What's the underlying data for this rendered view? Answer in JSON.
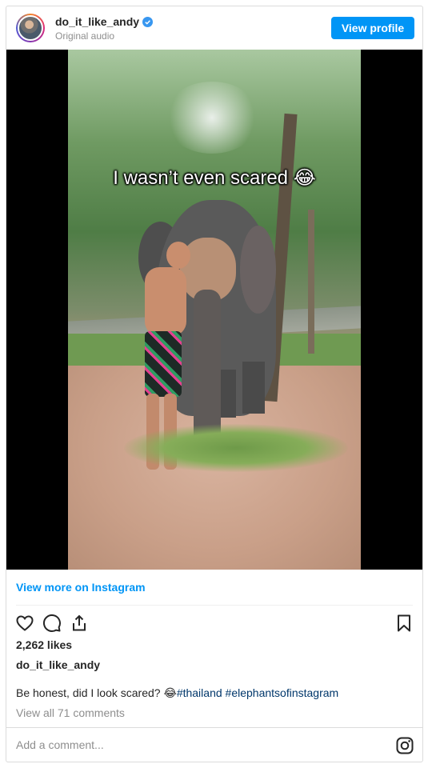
{
  "header": {
    "username": "do_it_like_andy",
    "audio_label": "Original audio",
    "view_profile_label": "View profile",
    "verified_icon": "verified-badge-icon"
  },
  "media": {
    "overlay_text": "I wasn’t even scared",
    "overlay_emoji": "😂"
  },
  "links": {
    "view_more": "View more on Instagram"
  },
  "actions": {
    "icons": [
      "heart-icon",
      "comment-icon",
      "share-icon",
      "bookmark-icon"
    ]
  },
  "post": {
    "likes": "2,262 likes",
    "author": "do_it_like_andy",
    "caption_text": "Be honest, did I look scared?",
    "caption_emoji": "😂",
    "hashtags": [
      "#thailand",
      "#elephantsofinstagram"
    ],
    "comments_link": "View all 71 comments"
  },
  "comment_box": {
    "placeholder": "Add a comment...",
    "icon": "instagram-icon"
  },
  "colors": {
    "accent": "#0095f6",
    "hashtag": "#00376b",
    "muted": "#8e8e8e"
  }
}
